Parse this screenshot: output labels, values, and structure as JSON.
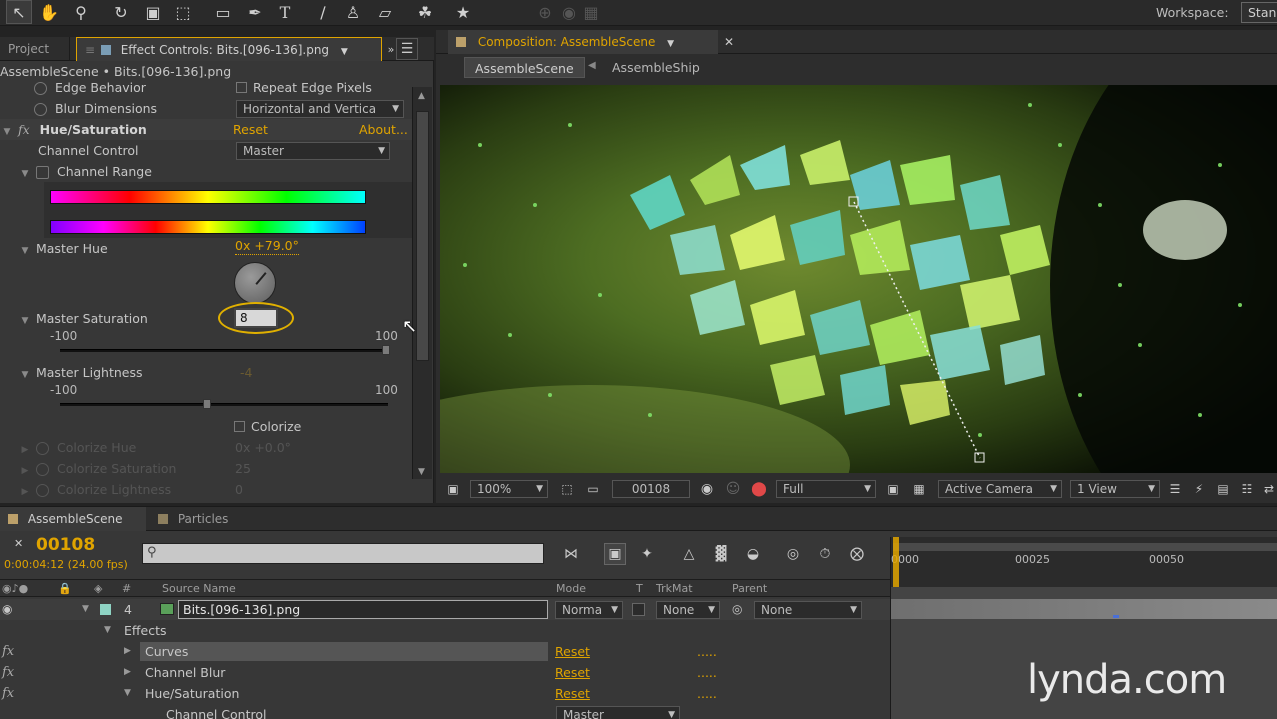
{
  "toolbar": {
    "workspace_label": "Workspace:",
    "workspace_value": "Stan"
  },
  "left_panel": {
    "tab_project": "Project",
    "tab_effect_controls": "Effect Controls: Bits.[096-136].png",
    "breadcrumb": "AssembleScene • Bits.[096-136].png",
    "edge_behavior": "Edge Behavior",
    "repeat_edge_pixels": "Repeat Edge Pixels",
    "blur_dimensions": "Blur Dimensions",
    "blur_dimensions_value": "Horizontal and Vertica",
    "effect_name": "Hue/Saturation",
    "reset": "Reset",
    "about": "About...",
    "channel_control": "Channel Control",
    "channel_control_value": "Master",
    "channel_range": "Channel Range",
    "master_hue": "Master Hue",
    "master_hue_value": "0x +79.0°",
    "master_saturation": "Master Saturation",
    "master_saturation_value": "8",
    "sat_min": "-100",
    "sat_max": "100",
    "master_lightness": "Master Lightness",
    "master_lightness_value": "-4",
    "light_min": "-100",
    "light_max": "100",
    "colorize": "Colorize",
    "colorize_hue": "Colorize Hue",
    "colorize_hue_value": "0x +0.0°",
    "colorize_saturation": "Colorize Saturation",
    "colorize_saturation_value": "25",
    "colorize_lightness": "Colorize Lightness",
    "colorize_lightness_value": "0"
  },
  "comp_panel": {
    "tab": "Composition: AssembleScene",
    "crumb_active": "AssembleScene",
    "crumb_next": "AssembleShip",
    "zoom": "100%",
    "timecode": "00108",
    "resolution": "Full",
    "camera": "Active Camera",
    "views": "1 View"
  },
  "timeline": {
    "tab_active": "AssembleScene",
    "tab_other": "Particles",
    "current_frame": "00108",
    "current_time": "0:00:04:12 (24.00 fps)",
    "search_placeholder": "",
    "col_num": "#",
    "col_source": "Source Name",
    "col_mode": "Mode",
    "col_t": "T",
    "col_trkmat": "TrkMat",
    "col_parent": "Parent",
    "ruler": [
      "0000",
      "00025",
      "00050"
    ],
    "layer_num": "4",
    "layer_name": "Bits.[096-136].png",
    "layer_mode": "Norma",
    "layer_trkmat": "None",
    "layer_parent": "None",
    "effects_label": "Effects",
    "effects": [
      {
        "name": "Curves",
        "reset": "Reset",
        "dots": "....."
      },
      {
        "name": "Channel Blur",
        "reset": "Reset",
        "dots": "....."
      },
      {
        "name": "Hue/Saturation",
        "reset": "Reset",
        "dots": "....."
      }
    ],
    "channel_control": "Channel Control",
    "channel_control_value": "Master"
  },
  "watermark": "lynda.com",
  "colors": {
    "accent": "#e0a400",
    "panel": "#393939",
    "dark": "#232323"
  }
}
